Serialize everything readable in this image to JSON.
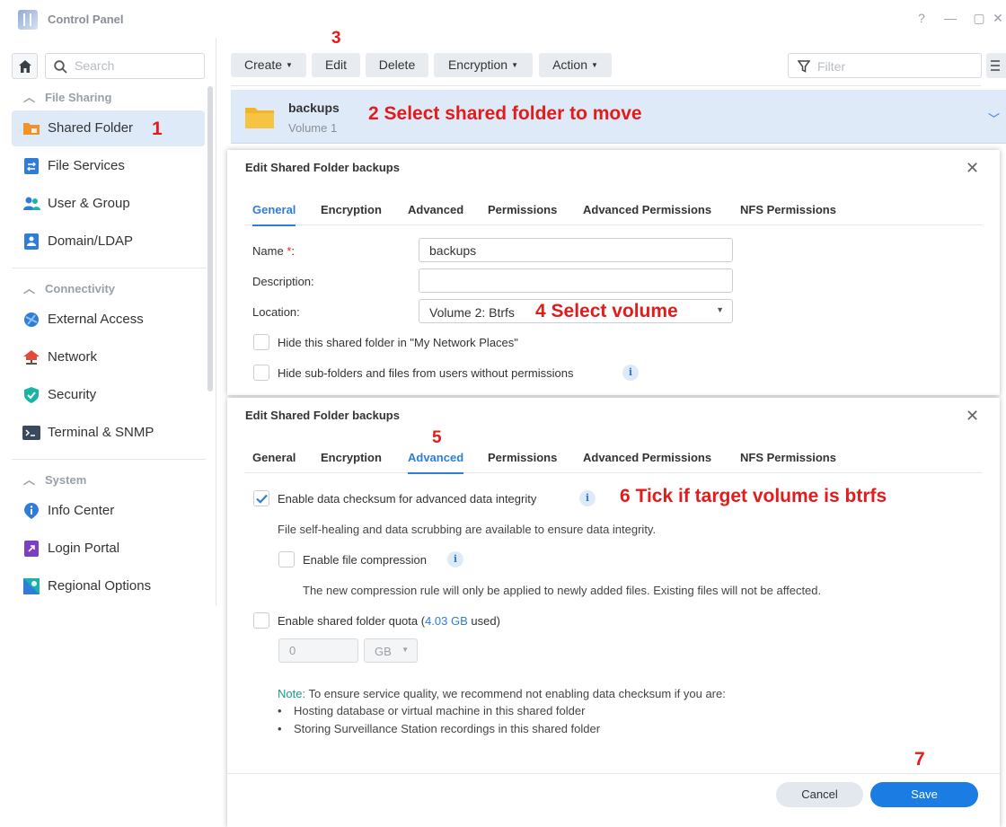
{
  "window": {
    "title": "Control Panel",
    "controls": {
      "help": "?",
      "minimize": "—",
      "maximize": "▢",
      "close": "✕"
    }
  },
  "sidebar": {
    "search_placeholder": "Search",
    "sections": [
      {
        "label": "File Sharing",
        "items": [
          {
            "label": "Shared Folder",
            "icon": "shared-folder-icon",
            "active": true
          },
          {
            "label": "File Services",
            "icon": "file-services-icon"
          },
          {
            "label": "User & Group",
            "icon": "user-group-icon"
          },
          {
            "label": "Domain/LDAP",
            "icon": "domain-ldap-icon"
          }
        ]
      },
      {
        "label": "Connectivity",
        "items": [
          {
            "label": "External Access",
            "icon": "external-access-icon"
          },
          {
            "label": "Network",
            "icon": "network-icon"
          },
          {
            "label": "Security",
            "icon": "security-shield-icon"
          },
          {
            "label": "Terminal & SNMP",
            "icon": "terminal-icon"
          }
        ]
      },
      {
        "label": "System",
        "items": [
          {
            "label": "Info Center",
            "icon": "info-center-icon"
          },
          {
            "label": "Login Portal",
            "icon": "login-portal-icon"
          },
          {
            "label": "Regional Options",
            "icon": "regional-options-icon"
          }
        ]
      }
    ]
  },
  "toolbar": {
    "create": "Create",
    "edit": "Edit",
    "delete": "Delete",
    "encryption": "Encryption",
    "action": "Action",
    "filter_placeholder": "Filter"
  },
  "folder": {
    "name": "backups",
    "volume": "Volume 1"
  },
  "annotations": {
    "step1": "1",
    "step2": "2  Select shared folder to move",
    "step3": "3",
    "step4": "4  Select volume",
    "step5": "5",
    "step6": "6  Tick if target volume is btrfs",
    "step7": "7"
  },
  "dialog_general": {
    "title": "Edit Shared Folder backups",
    "tabs": [
      "General",
      "Encryption",
      "Advanced",
      "Permissions",
      "Advanced Permissions",
      "NFS Permissions"
    ],
    "active_tab": "General",
    "name_label": "Name",
    "name_required": "*",
    "name_suffix": ":",
    "name_value": "backups",
    "description_label": "Description:",
    "description_value": "",
    "location_label": "Location:",
    "location_value": "Volume 2:  Btrfs",
    "hide_network_places": "Hide this shared folder in \"My Network Places\"",
    "hide_subfolders": "Hide sub-folders and files from users without permissions",
    "hide_network_places_checked": false,
    "hide_subfolders_checked": false
  },
  "dialog_advanced": {
    "title": "Edit Shared Folder backups",
    "tabs": [
      "General",
      "Encryption",
      "Advanced",
      "Permissions",
      "Advanced Permissions",
      "NFS Permissions"
    ],
    "active_tab": "Advanced",
    "checksum_label": "Enable data checksum for advanced data integrity",
    "checksum_checked": true,
    "checksum_hint": "File self-healing and data scrubbing are available to ensure data integrity.",
    "compression_label": "Enable file compression",
    "compression_checked": false,
    "compression_hint": "The new compression rule will only be applied to newly added files. Existing files will not be affected.",
    "quota_label_pre": "Enable shared folder quota (",
    "quota_used_value": "4.03 GB",
    "quota_label_post": " used)",
    "quota_checked": false,
    "quota_value": "0",
    "quota_unit": "GB",
    "note_label": "Note:",
    "note_text": " To ensure service quality, we recommend not enabling data checksum if you are:",
    "note_bullets": [
      "Hosting database or virtual machine in this shared folder",
      "Storing Surveillance Station recordings in this shared folder"
    ],
    "cancel": "Cancel",
    "save": "Save"
  },
  "colors": {
    "accent": "#1b7ce4",
    "selection": "#dfeaf8",
    "annotation": "#e21b1b",
    "note": "#1a9a8a"
  }
}
